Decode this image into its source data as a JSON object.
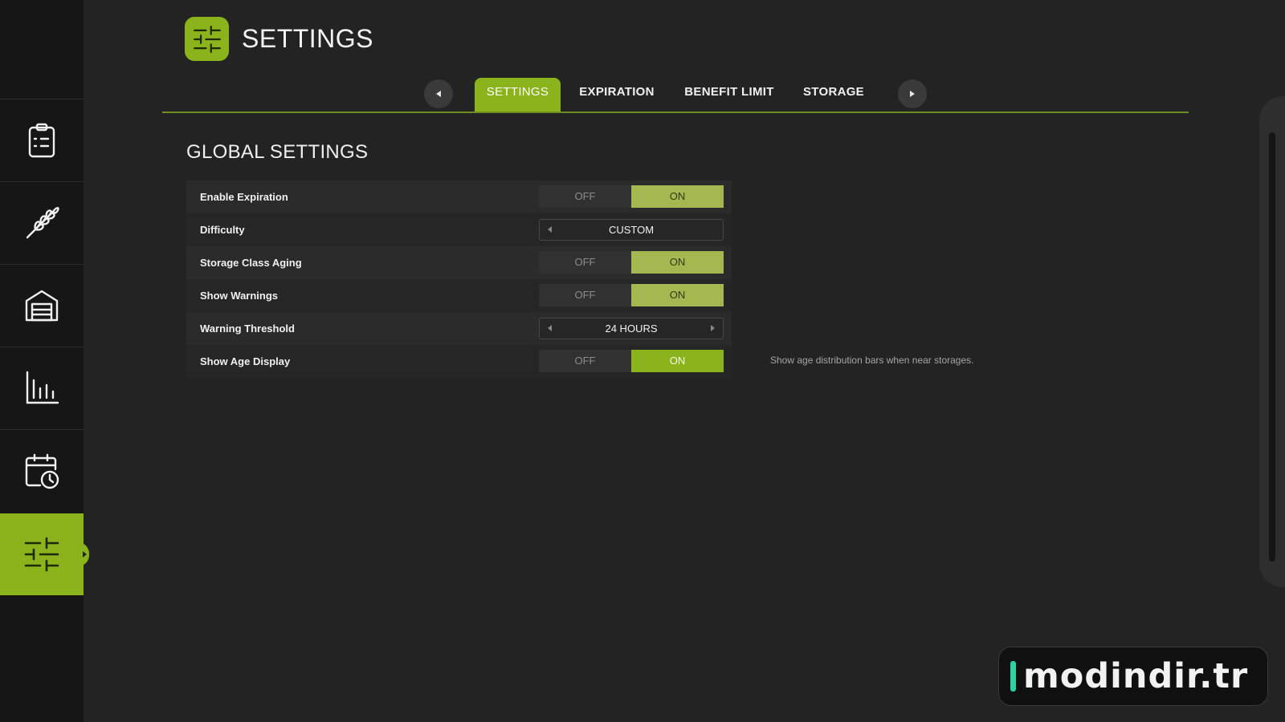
{
  "header": {
    "title": "SETTINGS",
    "icon": "sliders-icon",
    "accent_color": "#8ab31c"
  },
  "sidebar": {
    "items": [
      {
        "icon": "clipboard-icon"
      },
      {
        "icon": "wheat-icon"
      },
      {
        "icon": "warehouse-icon"
      },
      {
        "icon": "bar-chart-icon"
      },
      {
        "icon": "calendar-clock-icon"
      },
      {
        "icon": "sliders-icon",
        "active": true
      }
    ]
  },
  "tabs": [
    {
      "label": "SETTINGS",
      "active": true
    },
    {
      "label": "EXPIRATION"
    },
    {
      "label": "BENEFIT LIMIT"
    },
    {
      "label": "STORAGE"
    }
  ],
  "section": {
    "title": "GLOBAL SETTINGS",
    "rows": [
      {
        "label": "Enable Expiration",
        "type": "toggle",
        "off_label": "OFF",
        "on_label": "ON",
        "value": "ON"
      },
      {
        "label": "Difficulty",
        "type": "selector",
        "value": "CUSTOM"
      },
      {
        "label": "Storage Class Aging",
        "type": "toggle",
        "off_label": "OFF",
        "on_label": "ON",
        "value": "ON"
      },
      {
        "label": "Show Warnings",
        "type": "toggle",
        "off_label": "OFF",
        "on_label": "ON",
        "value": "ON"
      },
      {
        "label": "Warning Threshold",
        "type": "selector",
        "value": "24 HOURS"
      },
      {
        "label": "Show Age Display",
        "type": "toggle",
        "off_label": "OFF",
        "on_label": "ON",
        "value": "ON",
        "focused": true
      }
    ],
    "hint": "Show age distribution bars when near storages."
  },
  "watermark": {
    "text": "modindir.tr"
  }
}
